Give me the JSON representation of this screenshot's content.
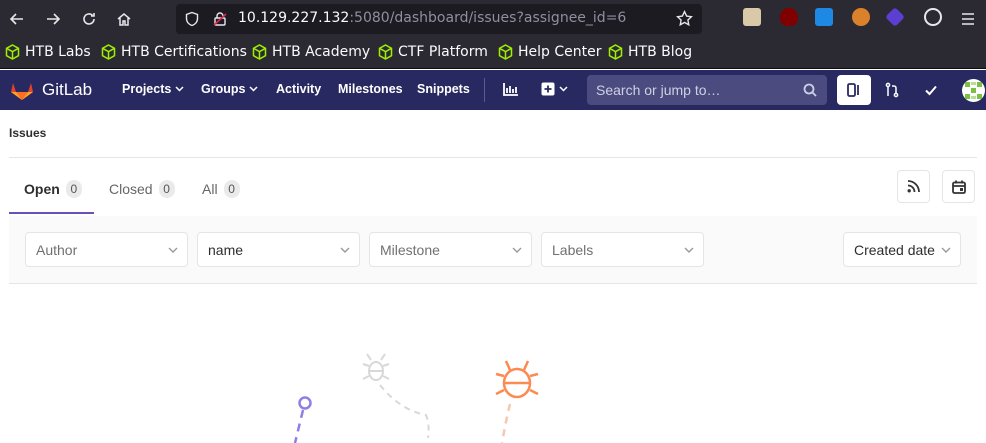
{
  "browser": {
    "url_host": "10.129.227.132",
    "url_rest": ":5080/dashboard/issues?assignee_id=6"
  },
  "bookmarks": [
    {
      "label": "HTB Labs"
    },
    {
      "label": "HTB Certifications"
    },
    {
      "label": "HTB Academy"
    },
    {
      "label": "CTF Platform"
    },
    {
      "label": "Help Center"
    },
    {
      "label": "HTB Blog"
    }
  ],
  "gitlab": {
    "brand": "GitLab",
    "nav": {
      "projects": "Projects",
      "groups": "Groups",
      "activity": "Activity",
      "milestones": "Milestones",
      "snippets": "Snippets"
    },
    "search_placeholder": "Search or jump to…"
  },
  "page": {
    "breadcrumb": "Issues",
    "tabs": [
      {
        "label": "Open",
        "count": "0"
      },
      {
        "label": "Closed",
        "count": "0"
      },
      {
        "label": "All",
        "count": "0"
      }
    ],
    "filters": {
      "author": "Author",
      "assignee": "name",
      "milestone": "Milestone",
      "labels": "Labels",
      "sort": "Created date"
    }
  },
  "colors": {
    "header_bg": "#292961",
    "accent": "#6b4fbb",
    "bookmark_icon": "#9fef00"
  }
}
